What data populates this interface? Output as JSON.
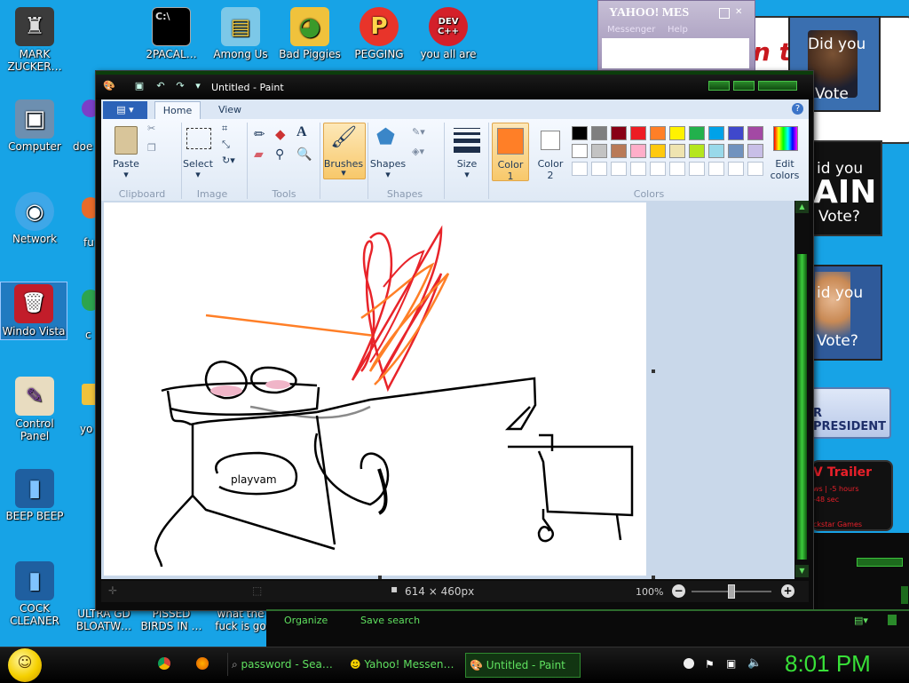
{
  "desktop_icons": [
    {
      "label": "MARK ZUCKER…",
      "glyph": "♜"
    },
    {
      "label": "Computer",
      "glyph": "▣"
    },
    {
      "label": "Network",
      "glyph": "◉"
    },
    {
      "label": "Windo Vista",
      "glyph": "🗑"
    },
    {
      "label": "Control Panel",
      "glyph": "✎"
    },
    {
      "label": "BEEP BEEP",
      "glyph": "▮"
    },
    {
      "label": "COCK CLEANER",
      "glyph": "▮"
    },
    {
      "label": "2PACAL…",
      "glyph": "C:\\"
    },
    {
      "label": "Among Us",
      "glyph": "▤"
    },
    {
      "label": "Bad Piggies",
      "glyph": "◕"
    },
    {
      "label": "PEGGING",
      "glyph": "P"
    },
    {
      "label": "you all are",
      "glyph": "DEV C++"
    },
    {
      "label": "doe",
      "glyph": ""
    },
    {
      "label": "fu",
      "glyph": ""
    },
    {
      "label": "c",
      "glyph": ""
    },
    {
      "label": "yo",
      "glyph": ""
    },
    {
      "label": "ULTRA GD BLOATW…",
      "glyph": ""
    },
    {
      "label": "PISSED BIRDS IN …",
      "glyph": ""
    },
    {
      "label": "what the fuck is go",
      "glyph": ""
    }
  ],
  "yahoo": {
    "title": "YAHOO! MES",
    "menu1": "Messenger",
    "menu2": "Help"
  },
  "ads": {
    "banner_t": "n t",
    "did_you_1": "Did you",
    "vote_1": "Vote",
    "did_you_2": "id you",
    "ain": "AIN",
    "vote_2": "Vote?",
    "did_you_3": "id you",
    "vote_3": "Vote?",
    "president": "R PRESIDENT",
    "trailer": "V Trailer",
    "trailer_l1": "ws | -5 hours",
    "trailer_l2": "-48 sec",
    "trailer_l3": "ckstar Games"
  },
  "paint": {
    "title": "Untitled - Paint",
    "tabs": {
      "menu": "▤ ▾",
      "home": "Home",
      "view": "View"
    },
    "groups": {
      "clipboard": "Clipboard",
      "image": "Image",
      "tools": "Tools",
      "shapes": "Shapes",
      "colors": "Colors"
    },
    "buttons": {
      "paste": "Paste",
      "select": "Select",
      "brushes": "Brushes",
      "shapes": "Shapes",
      "size": "Size",
      "color1": "Color",
      "color1_n": "1",
      "color2": "Color",
      "color2_n": "2",
      "edit_colors": "Edit colors"
    },
    "color1_value": "#ff7f27",
    "color2_value": "#ffffff",
    "palette": [
      "#000000",
      "#7f7f7f",
      "#880015",
      "#ed1c24",
      "#ff7f27",
      "#fff200",
      "#22b14c",
      "#00a2e8",
      "#3f48cc",
      "#a349a4",
      "#ffffff",
      "#c3c3c3",
      "#b97a57",
      "#ffaec9",
      "#ffc90e",
      "#efe4b0",
      "#b5e61d",
      "#99d9ea",
      "#7092be",
      "#c8bfe7"
    ],
    "canvas_text": "playvam",
    "status": {
      "dimensions": "614 × 460px",
      "zoom": "100%"
    }
  },
  "explorer": {
    "organize": "Organize",
    "save_search": "Save search"
  },
  "taskbar": {
    "items": [
      "password - Sea…",
      "Yahoo! Messen…",
      "Untitled - Paint"
    ],
    "clock": "8:01 PM"
  }
}
